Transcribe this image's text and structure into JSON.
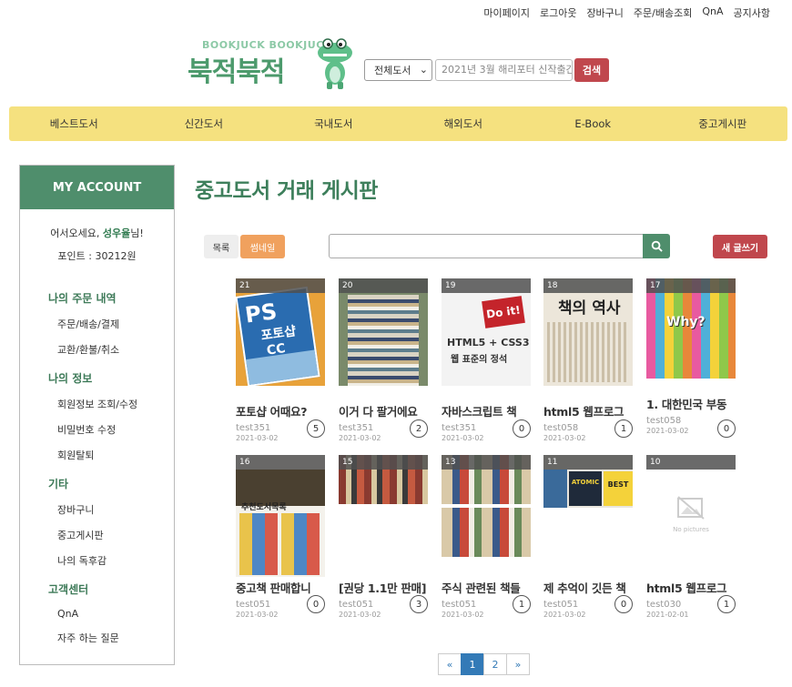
{
  "topnav": [
    "마이페이지",
    "로그아웃",
    "장바구니",
    "주문/배송조회",
    "QnA",
    "공지사항"
  ],
  "logo": {
    "sub": "BOOKJUCK BOOKJUCK",
    "main": "북적북적"
  },
  "search": {
    "category": "전체도서",
    "placeholder": "2021년 3월 해리포터 신작출간",
    "button": "검색"
  },
  "mainnav": [
    "베스트도서",
    "신간도서",
    "국내도서",
    "해외도서",
    "E-Book",
    "중고게시판"
  ],
  "sidebar": {
    "header": "MY ACCOUNT",
    "welcome_prefix": "어서오세요, ",
    "welcome_name": "성우율",
    "welcome_suffix": "님!",
    "points": "포인트 : 30212원",
    "sections": [
      {
        "title": "나의 주문 내역",
        "items": [
          "주문/배송/결제",
          "교환/환불/취소"
        ]
      },
      {
        "title": "나의 정보",
        "items": [
          "회원정보 조회/수정",
          "비밀번호 수정",
          "회원탈퇴"
        ]
      },
      {
        "title": "기타",
        "items": [
          "장바구니",
          "중고게시판",
          "나의 독후감"
        ]
      },
      {
        "title": "고객센터",
        "items": [
          "QnA",
          "자주 하는 질문"
        ]
      }
    ]
  },
  "board": {
    "title": "중고도서 거래 게시판",
    "tab_list": "목록",
    "tab_thumb": "썸네일",
    "write_button": "새 글쓰기",
    "search_value": ""
  },
  "posts": [
    {
      "num": "21",
      "title": "포토샵 어때요?",
      "author": "test351",
      "date": "2021-03-02",
      "comments": "5"
    },
    {
      "num": "20",
      "title": "이거 다 팔거에요",
      "author": "test351",
      "date": "2021-03-02",
      "comments": "2"
    },
    {
      "num": "19",
      "title": "자바스크립트 책",
      "author": "test351",
      "date": "2021-03-02",
      "comments": "0"
    },
    {
      "num": "18",
      "title": "html5 웹프로그",
      "author": "test058",
      "date": "2021-03-02",
      "comments": "1"
    },
    {
      "num": "17",
      "title": "1. 대한민국 부동",
      "author": "test058",
      "date": "2021-03-02",
      "comments": "0"
    },
    {
      "num": "16",
      "title": "중고책 판매합니",
      "author": "test051",
      "date": "2021-03-02",
      "comments": "0"
    },
    {
      "num": "15",
      "title": "[권당 1.1만 판매]",
      "author": "test051",
      "date": "2021-03-02",
      "comments": "3"
    },
    {
      "num": "13",
      "title": "주식 관련된 책들",
      "author": "test051",
      "date": "2021-03-02",
      "comments": "1"
    },
    {
      "num": "11",
      "title": "제 추억이 깃든 책",
      "author": "test051",
      "date": "2021-03-02",
      "comments": "0"
    },
    {
      "num": "10",
      "title": "html5 웹프로그",
      "author": "test030",
      "date": "2021-02-01",
      "comments": "1"
    }
  ],
  "thumb_text": {
    "ps_title": "PS",
    "ps_sub": "포토샵",
    "ps_cc": "CC",
    "doit": "Do it!",
    "html5": "HTML5 + CSS3",
    "html5_sub": "웹 표준의 정석",
    "history": "책의 역사",
    "why": "Why?",
    "used_rec": "추천도서목록",
    "atomic": "ATOMIC",
    "best": "BEST",
    "no_picture": "No pictures"
  },
  "pager": {
    "prev": "«",
    "pages": [
      "1",
      "2"
    ],
    "next": "»",
    "active": "1"
  }
}
